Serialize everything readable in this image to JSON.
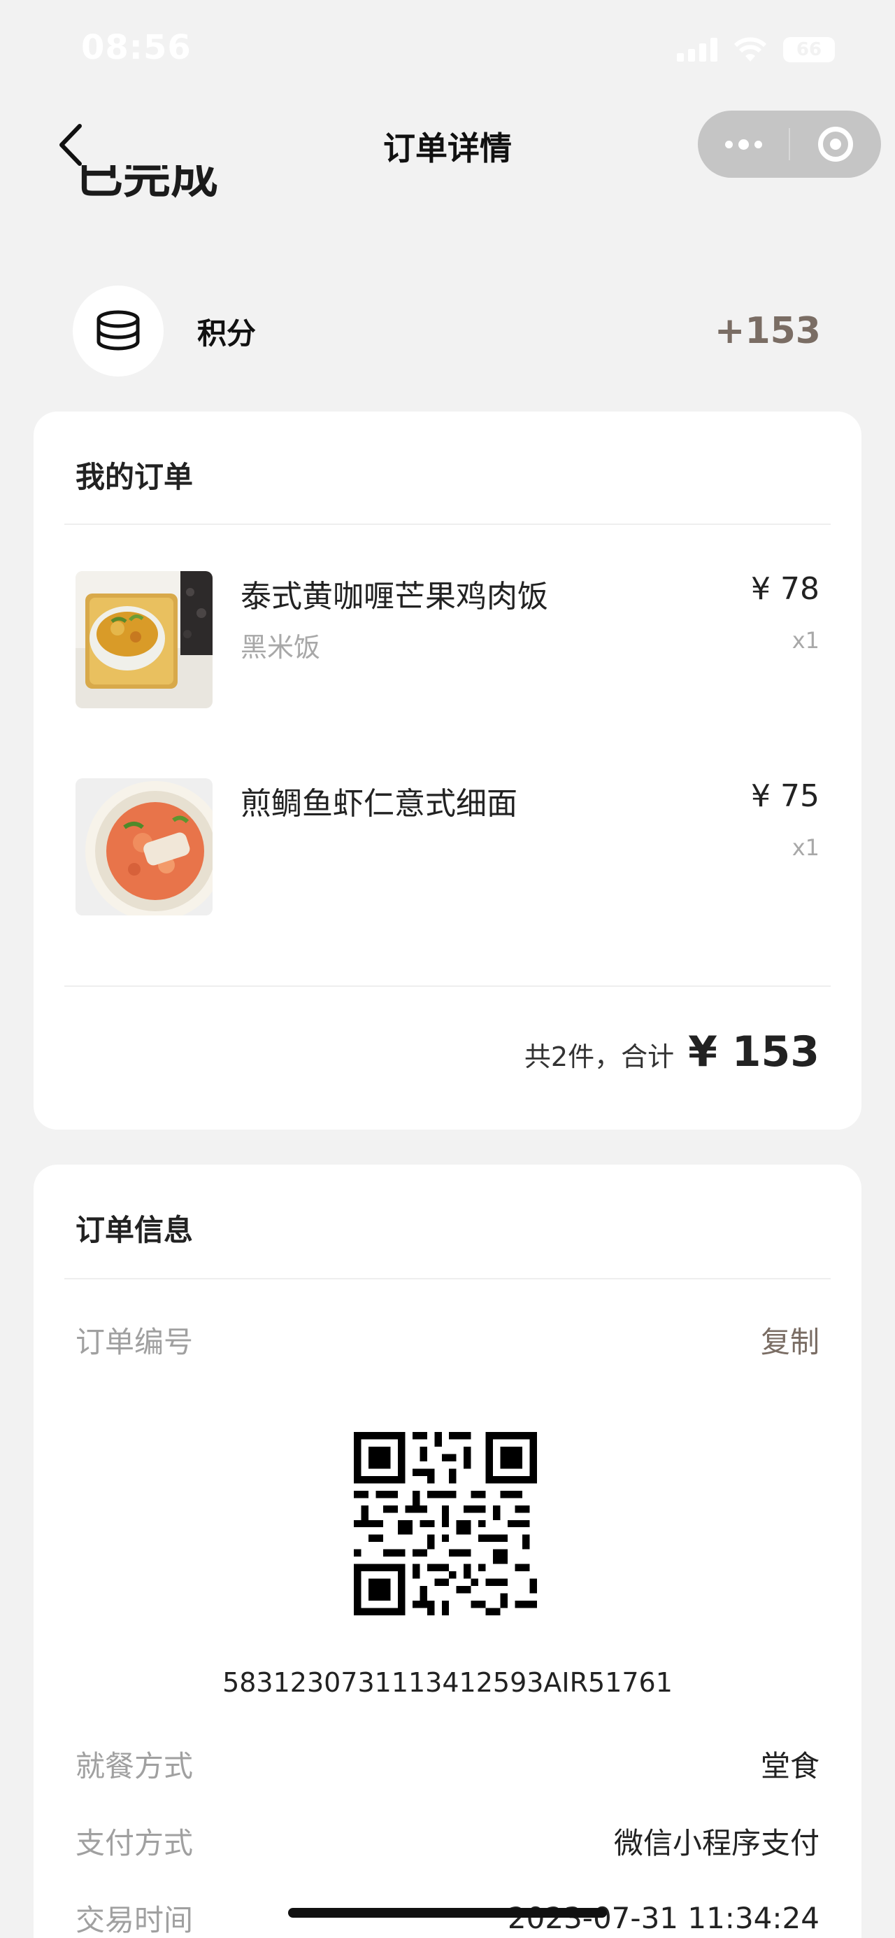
{
  "status_bar": {
    "time": "08:56",
    "battery": "66"
  },
  "nav": {
    "title": "订单详情"
  },
  "order_status": "已完成",
  "points": {
    "label": "积分",
    "value": "+153"
  },
  "order": {
    "title": "我的订单",
    "items": [
      {
        "name": "泰式黄咖喱芒果鸡肉饭",
        "spec": "黑米饭",
        "price": "¥ 78",
        "qty": "x1"
      },
      {
        "name": "煎鲷鱼虾仁意式细面",
        "spec": "",
        "price": "¥ 75",
        "qty": "x1"
      }
    ],
    "summary_label": "共2件，合计",
    "summary_total": "¥ 153"
  },
  "info": {
    "title": "订单信息",
    "order_no_label": "订单编号",
    "copy_label": "复制",
    "order_number": "5831230731113412593AIR51761",
    "rows": [
      {
        "label": "就餐方式",
        "value": "堂食"
      },
      {
        "label": "支付方式",
        "value": "微信小程序支付"
      },
      {
        "label": "交易时间",
        "value": "2023-07-31 11:34:24"
      }
    ]
  },
  "icons": {
    "back": "chevron-left-icon",
    "more": "more-dots-icon",
    "close": "capsule-close-icon",
    "points": "coin-stack-icon"
  }
}
